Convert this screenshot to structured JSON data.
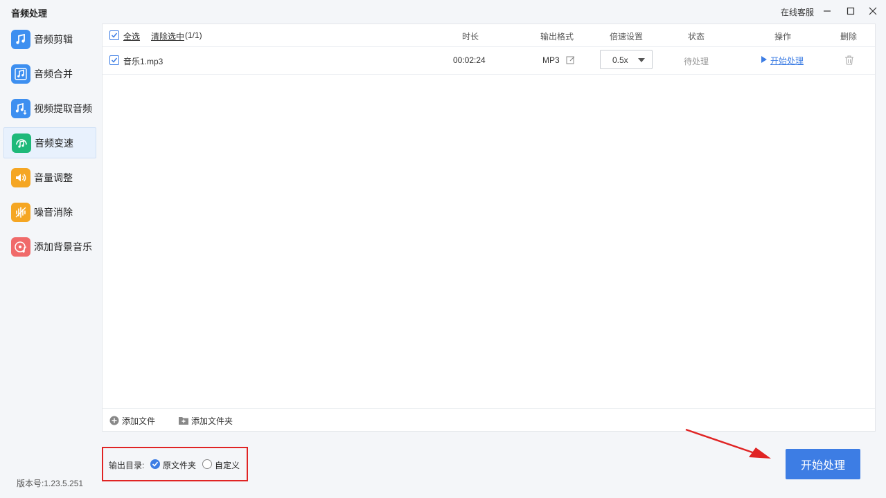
{
  "app": {
    "title": "音频处理",
    "service": "在线客服",
    "version": "版本号:1.23.5.251"
  },
  "sidebar": {
    "items": [
      {
        "label": "音频剪辑",
        "icon": "music-scissors-icon",
        "color": "#3d8ff0",
        "active": false
      },
      {
        "label": "音频合并",
        "icon": "music-merge-icon",
        "color": "#3d8ff0",
        "active": false
      },
      {
        "label": "视频提取音频",
        "icon": "music-extract-icon",
        "color": "#3d8ff0",
        "active": false
      },
      {
        "label": "音频变速",
        "icon": "music-speed-icon",
        "color": "#1eb97a",
        "active": true
      },
      {
        "label": "音量调整",
        "icon": "speaker-icon",
        "color": "#f5a623",
        "active": false
      },
      {
        "label": "噪音消除",
        "icon": "noise-wave-icon",
        "color": "#f5a623",
        "active": false
      },
      {
        "label": "添加背景音乐",
        "icon": "disc-music-icon",
        "color": "#f06a6a",
        "active": false
      }
    ]
  },
  "table": {
    "select_all": "全选",
    "clear_selection": "清除选中",
    "selection_count": "(1/1)",
    "columns": {
      "duration": "时长",
      "format": "输出格式",
      "speed": "倍速设置",
      "status": "状态",
      "action": "操作",
      "delete": "删除"
    },
    "rows": [
      {
        "checked": true,
        "name": "音乐1.mp3",
        "duration": "00:02:24",
        "format": "MP3",
        "speed": "0.5x",
        "status": "待处理",
        "action": "开始处理"
      }
    ]
  },
  "footer": {
    "add_file": "添加文件",
    "add_folder": "添加文件夹"
  },
  "output": {
    "label": "输出目录:",
    "option_original": "原文件夹",
    "option_custom": "自定义",
    "selected": "原文件夹"
  },
  "start_button": "开始处理",
  "colors": {
    "accent": "#3d7de4",
    "highlight_box": "#e02424",
    "arrow": "#e02424"
  }
}
